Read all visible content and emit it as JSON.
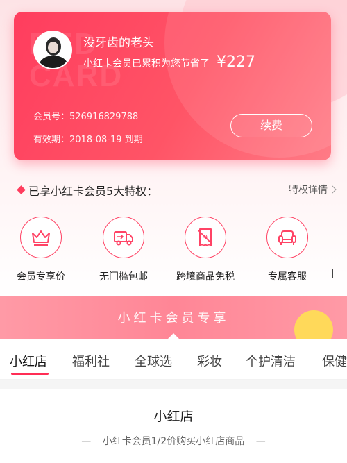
{
  "card": {
    "watermark": "RED\nCARD",
    "username": "没牙齿的老头",
    "saved_text": "小红卡会员已累积为您节省了",
    "saved_amount": "¥227",
    "member_no": "会员号：526916829788",
    "valid_until": "有效期：2018-08-19 到期",
    "renew_button": "续费"
  },
  "privileges": {
    "title": "已享小红卡会员5大特权：",
    "more_link": "特权详情",
    "items": [
      {
        "label": "会员专享价",
        "icon": "crown-icon"
      },
      {
        "label": "无门槛包邮",
        "icon": "truck-icon"
      },
      {
        "label": "跨境商品免税",
        "icon": "tax-free-icon"
      },
      {
        "label": "专属客服",
        "icon": "sofa-icon"
      }
    ]
  },
  "banner": {
    "title": "小红卡会员专享"
  },
  "tabs": [
    "小红店",
    "福利社",
    "全球选",
    "彩妆",
    "个护清洁",
    "保健"
  ],
  "section": {
    "title": "小红店",
    "subtitle": "小红卡会员1/2价购买小红店商品"
  },
  "colors": {
    "accent": "#ff3d5e",
    "tab_underline": "#ff2d55",
    "banner": "#ff8e9c"
  }
}
